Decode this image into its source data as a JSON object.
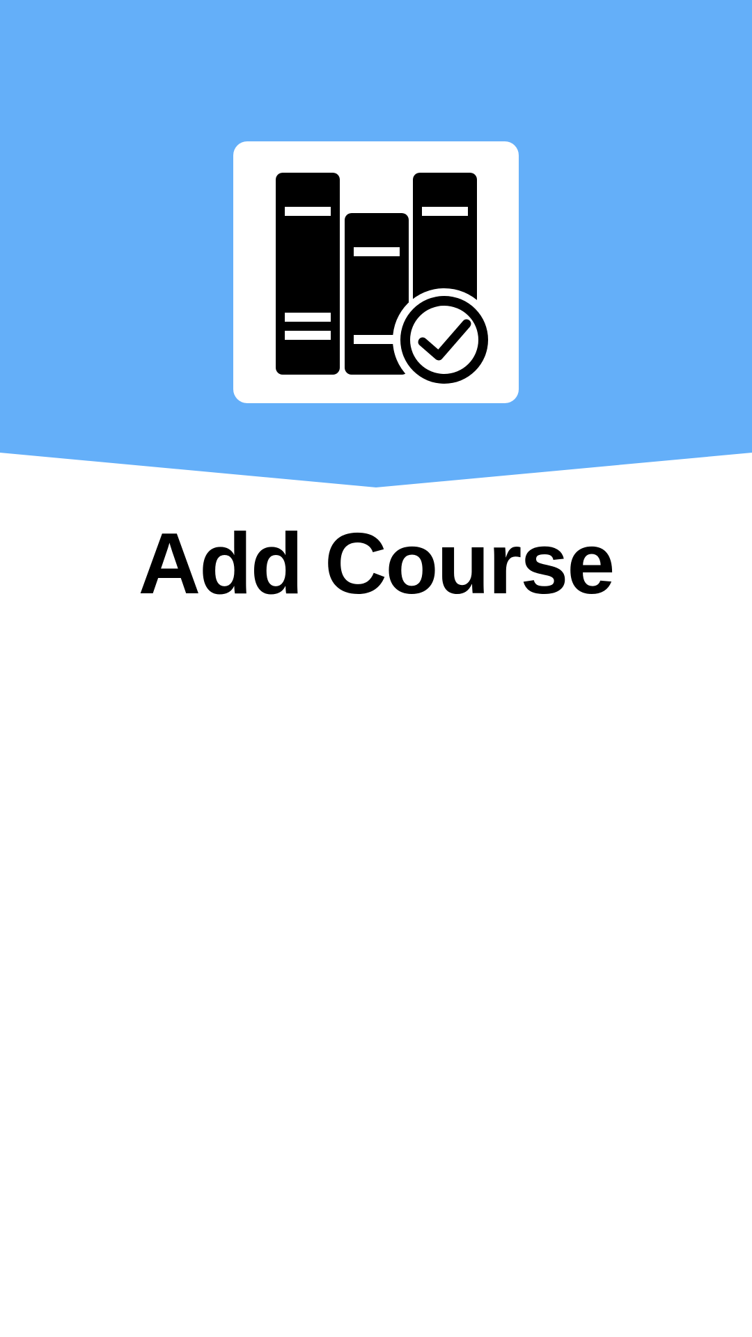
{
  "header": {
    "background_color": "#64AFF9",
    "icon": "books-with-checkmark-icon",
    "icon_card_color": "#FFFFFF"
  },
  "main": {
    "title": "Add Course"
  }
}
